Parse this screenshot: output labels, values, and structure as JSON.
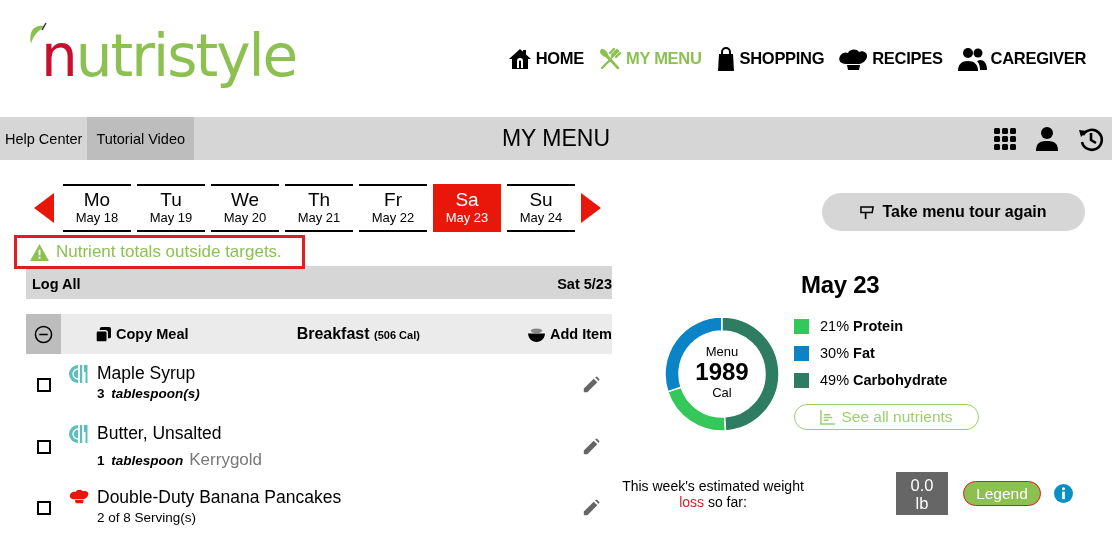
{
  "logo": [
    "n",
    "utristyle"
  ],
  "nav": [
    {
      "label": "HOME",
      "kind": "home",
      "selected": false
    },
    {
      "label": "MY MENU",
      "kind": "menu",
      "selected": true
    },
    {
      "label": "SHOPPING",
      "kind": "shopping",
      "selected": false
    },
    {
      "label": "RECIPES",
      "kind": "recipes",
      "selected": false
    },
    {
      "label": "CAREGIVER",
      "kind": "caregiver",
      "selected": false
    }
  ],
  "toolbar": {
    "links": [
      {
        "label": "Help Center",
        "selected": false
      },
      {
        "label": "Tutorial Video",
        "selected": true
      }
    ],
    "title": "MY MENU"
  },
  "week": [
    {
      "day": "Mo",
      "date": "May 18",
      "selected": false
    },
    {
      "day": "Tu",
      "date": "May 19",
      "selected": false
    },
    {
      "day": "We",
      "date": "May 20",
      "selected": false
    },
    {
      "day": "Th",
      "date": "May 21",
      "selected": false
    },
    {
      "day": "Fr",
      "date": "May 22",
      "selected": false
    },
    {
      "day": "Sa",
      "date": "May 23",
      "selected": true
    },
    {
      "day": "Su",
      "date": "May 24",
      "selected": false
    }
  ],
  "warning": "Nutrient totals outside targets.",
  "log_bar": {
    "action": "Log All",
    "date": "Sat 5/23"
  },
  "meal": {
    "copy": "Copy Meal",
    "name": "Breakfast",
    "calories": "(506 Cal)",
    "add": "Add Item",
    "expanded": true,
    "items": [
      {
        "kind": "food",
        "name": "Maple Syrup",
        "quantity": "3",
        "unit": "tablespoon(s)",
        "checked": false
      },
      {
        "kind": "food",
        "name": "Butter, Unsalted",
        "quantity": "1",
        "unit": "tablespoon",
        "brand": "Kerrygold",
        "checked": false
      },
      {
        "kind": "recipe",
        "name": "Double-Duty Banana Pancakes",
        "servings": "2 of 8 Serving(s)",
        "checked": false
      }
    ]
  },
  "tour_button": "Take menu tour again",
  "summary": {
    "date": "May 23",
    "center": {
      "top": "Menu",
      "value": "1989",
      "unit": "Cal"
    },
    "legend": [
      {
        "percent": "21%",
        "color": "#34c759"
      },
      {
        "percent": "30%",
        "color": "#0a84c6"
      },
      {
        "percent": "49%",
        "color": "#2e7d62"
      }
    ],
    "chart_data": {
      "type": "donut",
      "categories": [
        "Protein",
        "Fat",
        "Carbohydrate"
      ],
      "values": [
        21,
        30,
        49
      ]
    },
    "nutrients_button": "See all nutrients"
  },
  "weight": {
    "before": "This week's estimated weight ",
    "highlight": "loss",
    "after": " so far:",
    "value": "0.0",
    "unit": "lb",
    "legend_button": "Legend"
  }
}
